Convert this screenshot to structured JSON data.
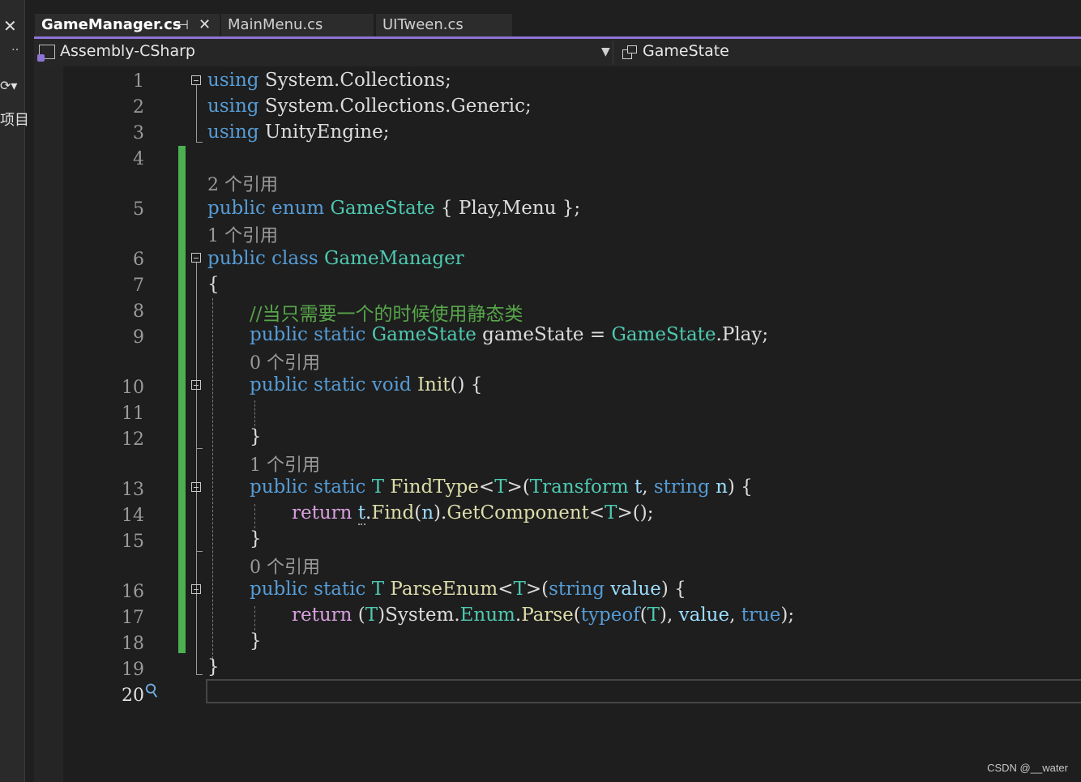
{
  "tabs": [
    {
      "label": "GameManager.cs",
      "active": true
    },
    {
      "label": "MainMenu.cs",
      "active": false
    },
    {
      "label": "UITween.cs",
      "active": false
    }
  ],
  "nav": {
    "project": "Assembly-CSharp",
    "member": "GameState"
  },
  "left_panel": {
    "label": "项目"
  },
  "line_numbers": [
    "1",
    "2",
    "3",
    "4",
    "5",
    "6",
    "7",
    "8",
    "9",
    "10",
    "11",
    "12",
    "13",
    "14",
    "15",
    "16",
    "17",
    "18",
    "19",
    "20"
  ],
  "lens": {
    "l5": "2 个引用",
    "l6": "1 个引用",
    "l10": "0 个引用",
    "l13": "1 个引用",
    "l16": "0 个引用"
  },
  "comment": "//当只需要一个的时候使用静态类",
  "watermark": "CSDN @__water",
  "colors": {
    "keyword": "#569cd6",
    "type": "#4ec9b0",
    "method": "#dcdcaa",
    "control": "#d8a0df",
    "comment": "#57a64a",
    "accent": "#8e74d6",
    "change_bar": "#4caf50"
  }
}
